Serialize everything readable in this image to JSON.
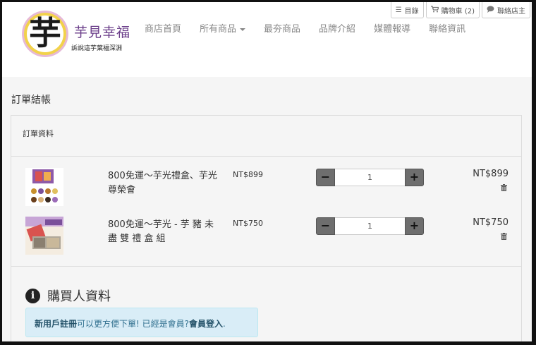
{
  "header": {
    "logo_char": "芋",
    "logo_title": "芋見幸福",
    "logo_subtitle": "訴說這芋葉福深淵",
    "nav": [
      {
        "label": "商店首頁"
      },
      {
        "label": "所有商品",
        "dropdown": true
      },
      {
        "label": "最夯商品"
      },
      {
        "label": "品牌介紹"
      },
      {
        "label": "媒體報導"
      },
      {
        "label": "聯絡資訊"
      }
    ],
    "top_buttons": [
      {
        "icon": "list-icon",
        "label": "目錄"
      },
      {
        "icon": "cart-icon",
        "label": "購物車 (2)"
      },
      {
        "icon": "chat-icon",
        "label": "聯絡店主"
      }
    ]
  },
  "page": {
    "title": "訂單結帳",
    "panel_title": "訂單資料"
  },
  "order_items": [
    {
      "name": "800免運～芋光禮盒、芋光尊榮會",
      "unit_price": "NT$899",
      "quantity": "1",
      "total": "NT$899",
      "minus": "−",
      "plus": "+"
    },
    {
      "name": "800免運～芋光 - 芋 豬 未 盡 雙 禮 盒 組",
      "unit_price": "NT$750",
      "quantity": "1",
      "total": "NT$750",
      "minus": "−",
      "plus": "+"
    }
  ],
  "buyer": {
    "title": "購買人資料",
    "notice_register": "新用戶註冊",
    "notice_middle": "可以更方便下單! 已經是會員?",
    "notice_login": "會員登入",
    "notice_end": "."
  },
  "colors": {
    "stepper": "#6e6e6e",
    "notice_bg": "#d9edf7",
    "logo_purple": "#6b3e8a"
  }
}
